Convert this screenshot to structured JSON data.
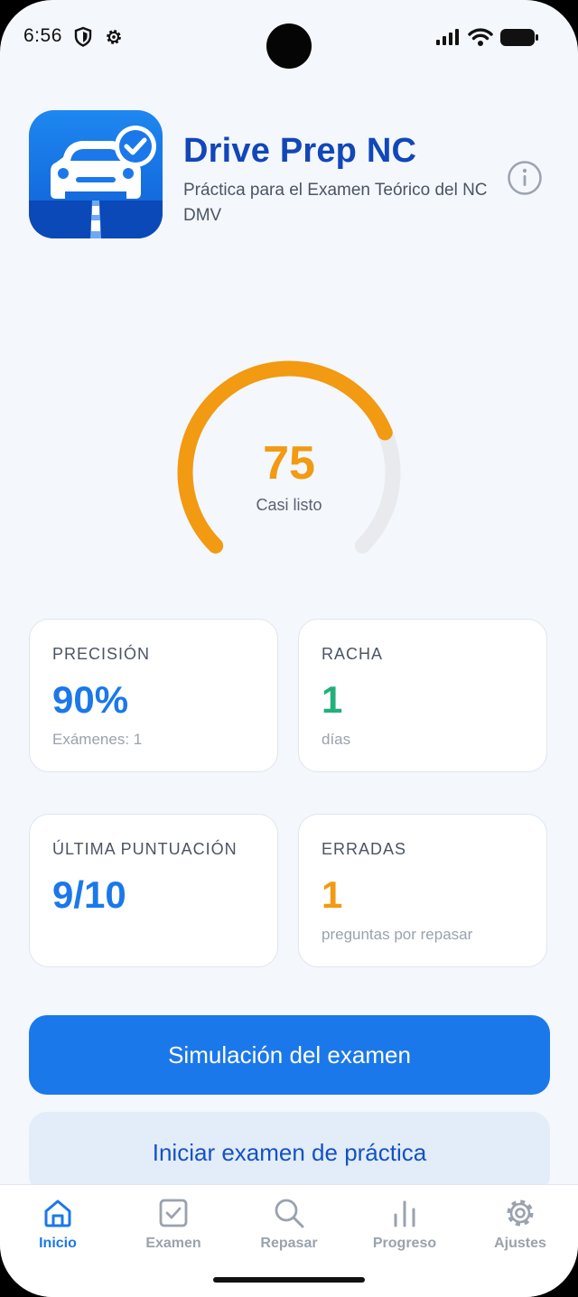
{
  "status_bar": {
    "time": "6:56",
    "icons": [
      "shield-icon",
      "gear-icon",
      "signal-icon",
      "wifi-icon",
      "battery-icon"
    ]
  },
  "header": {
    "title": "Drive Prep NC",
    "subtitle": "Práctica para el Examen Teórico del NC DMV",
    "app_icon": "car-check-icon",
    "info_icon": "info-icon"
  },
  "readiness": {
    "score": "75",
    "level": 0.75,
    "label": "Casi listo",
    "colors": {
      "arc": "#f29a12",
      "track": "#e8eaee"
    }
  },
  "stats": [
    {
      "label": "PRECISIÓN",
      "value": "90%",
      "caption": "Exámenes: 1",
      "color": "#1b78ea"
    },
    {
      "label": "RACHA",
      "value": "1",
      "caption": "días",
      "color": "#22b07a"
    },
    {
      "label": "ÚLTIMA PUNTUACIÓN",
      "value": "9/10",
      "caption": "",
      "color": "#1b78ea"
    },
    {
      "label": "ERRADAS",
      "value": "1",
      "caption": "preguntas por repasar",
      "color": "#f29a12"
    }
  ],
  "actions": {
    "primary": "Simulación del examen",
    "secondary": "Iniciar examen de práctica"
  },
  "nav": {
    "items": [
      {
        "label": "Inicio",
        "icon": "home-icon",
        "active": true
      },
      {
        "label": "Examen",
        "icon": "checkbox-icon",
        "active": false
      },
      {
        "label": "Repasar",
        "icon": "search-icon",
        "active": false
      },
      {
        "label": "Progreso",
        "icon": "bar-chart-icon",
        "active": false
      },
      {
        "label": "Ajustes",
        "icon": "gear-icon",
        "active": false
      }
    ]
  },
  "colors": {
    "accent": "#1b78ea",
    "title": "#1147b8",
    "background": "#f4f7fc"
  }
}
